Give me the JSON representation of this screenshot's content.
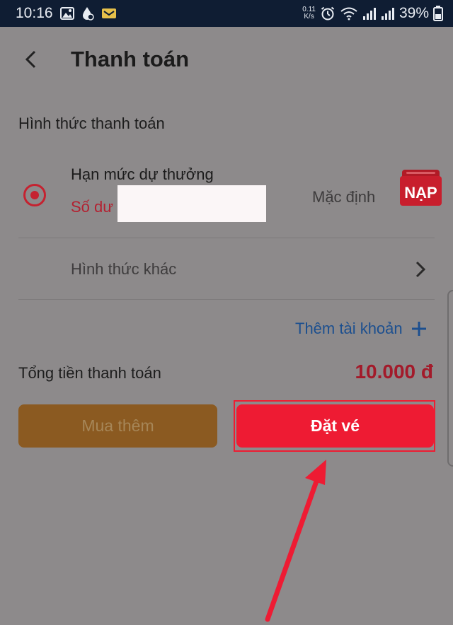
{
  "status_bar": {
    "time": "10:16",
    "net_speed_value": "0.11",
    "net_speed_unit": "K/s",
    "battery": "39%"
  },
  "header": {
    "title": "Thanh toán"
  },
  "payment": {
    "section_title": "Hình thức thanh toán",
    "method_name": "Hạn mức dự thưởng",
    "balance_label": "Số dư",
    "default_label": "Mặc định",
    "topup_label": "NẠP",
    "other_methods_label": "Hình thức khác",
    "add_account_label": "Thêm tài khoản"
  },
  "total": {
    "label": "Tổng tiền thanh toán",
    "value": "10.000 đ"
  },
  "actions": {
    "buy_more_label": "Mua thêm",
    "order_label": "Đặt vé"
  },
  "colors": {
    "accent_red": "#ee1b33",
    "gold": "#8b5a21",
    "link_blue": "#1c4f8f"
  }
}
